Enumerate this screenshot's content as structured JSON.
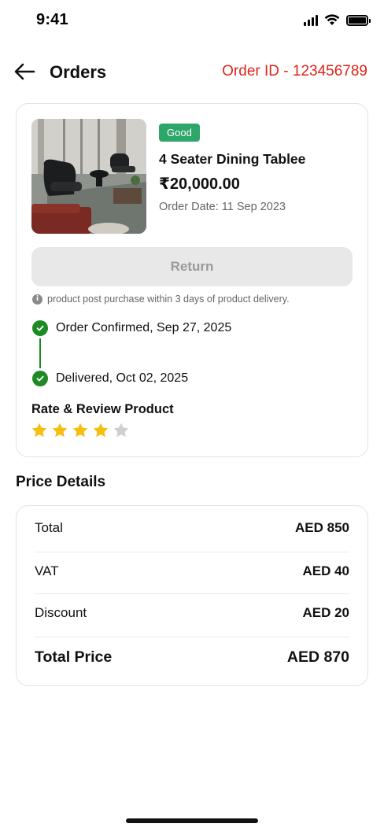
{
  "status_bar": {
    "time": "9:41"
  },
  "header": {
    "title": "Orders",
    "order_id": "Order ID  - 123456789"
  },
  "order": {
    "badge": "Good",
    "product_name": "4 Seater Dining Tablee",
    "price": "₹20,000.00",
    "order_date": "Order Date: 11 Sep 2023",
    "return_label": "Return",
    "info_note": "product post purchase within 3 days of product delivery.",
    "timeline": [
      {
        "label": "Order Confirmed, Sep 27, 2025"
      },
      {
        "label": "Delivered, Oct 02, 2025"
      }
    ],
    "rate_title": "Rate & Review Product",
    "rating": {
      "value": 4,
      "max": 5
    }
  },
  "price_details": {
    "title": "Price Details",
    "rows": [
      {
        "label": "Total",
        "value": "AED 850"
      },
      {
        "label": "VAT",
        "value": "AED 40"
      },
      {
        "label": "Discount",
        "value": "AED 20"
      }
    ],
    "total": {
      "label": "Total Price",
      "value": "AED 870"
    }
  },
  "colors": {
    "accent_red": "#e0251b",
    "badge_green": "#2ea66a",
    "timeline_green": "#1e8a25",
    "star_filled": "#f5bf0f",
    "star_empty": "#cfcfcf"
  }
}
